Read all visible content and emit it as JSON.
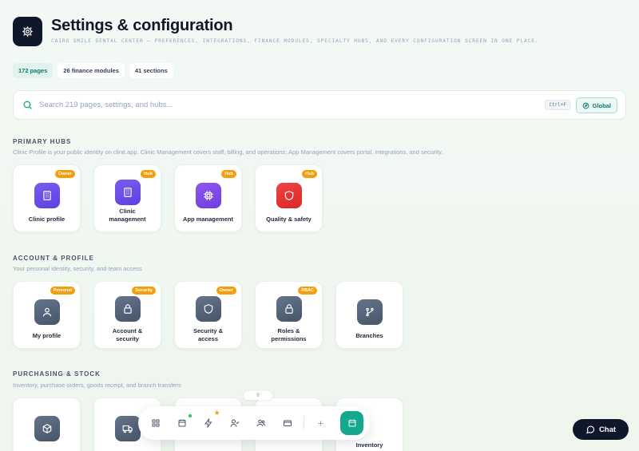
{
  "header": {
    "title": "Settings & configuration",
    "subtitle": "CAIRO SMILE DENTAL CENTER — PREFERENCES, INTEGRATIONS, FINANCE MODULES, SPECIALTY HUBS, AND EVERY CONFIGURATION SCREEN IN ONE PLACE.",
    "icon": "gear-icon"
  },
  "stats": [
    "172 pages",
    "26 finance modules",
    "41 sections"
  ],
  "search": {
    "placeholder": "Search 219 pages, settings, and hubs...",
    "shortcut": "Ctrl+F",
    "scope_label": "Global"
  },
  "sections": [
    {
      "title": "PRIMARY HUBS",
      "desc": "Clinic Profile is your public identity on clinit.app. Clinic Management covers staff, billing, and operations; App Management covers portal, integrations, and security.",
      "cards": [
        {
          "label": "Clinic profile",
          "badge": "Owner",
          "icon": "building-icon"
        },
        {
          "label": "Clinic management",
          "badge": "Hub",
          "icon": "building-icon"
        },
        {
          "label": "App management",
          "badge": "Hub",
          "icon": "chip-icon"
        },
        {
          "label": "Quality & safety",
          "badge": "Hub",
          "icon": "shield-icon"
        }
      ]
    },
    {
      "title": "ACCOUNT & PROFILE",
      "desc": "Your personal identity, security, and team access",
      "cards": [
        {
          "label": "My profile",
          "badge": "Personal",
          "icon": "user-icon"
        },
        {
          "label": "Account & security",
          "badge": "Security",
          "icon": "lock-icon"
        },
        {
          "label": "Security & access",
          "badge": "Owner",
          "icon": "shield-icon"
        },
        {
          "label": "Roles & permissions",
          "badge": "RBAC",
          "icon": "lock-icon"
        },
        {
          "label": "Branches",
          "badge": "",
          "icon": "branch-icon"
        }
      ]
    },
    {
      "title": "PURCHASING & STOCK",
      "desc": "Inventory, purchase orders, goods receipt, and branch transfers",
      "cards": [
        {
          "label": "",
          "icon": "box-icon"
        },
        {
          "label": "",
          "icon": "truck-icon"
        },
        {
          "label": "",
          "icon": ""
        },
        {
          "label": "",
          "icon": ""
        },
        {
          "label": "Inventory",
          "icon": ""
        }
      ]
    }
  ],
  "dock": {
    "items": [
      "grid-icon",
      "calendar-icon",
      "bolt-icon",
      "user-check-icon",
      "users-icon",
      "card-icon",
      "plus-icon",
      "calendar-icon"
    ]
  },
  "chat": {
    "label": "Chat"
  },
  "colors": {
    "accent": "#14a88c",
    "badge": "#f59e0b",
    "dark": "#0f172a"
  }
}
